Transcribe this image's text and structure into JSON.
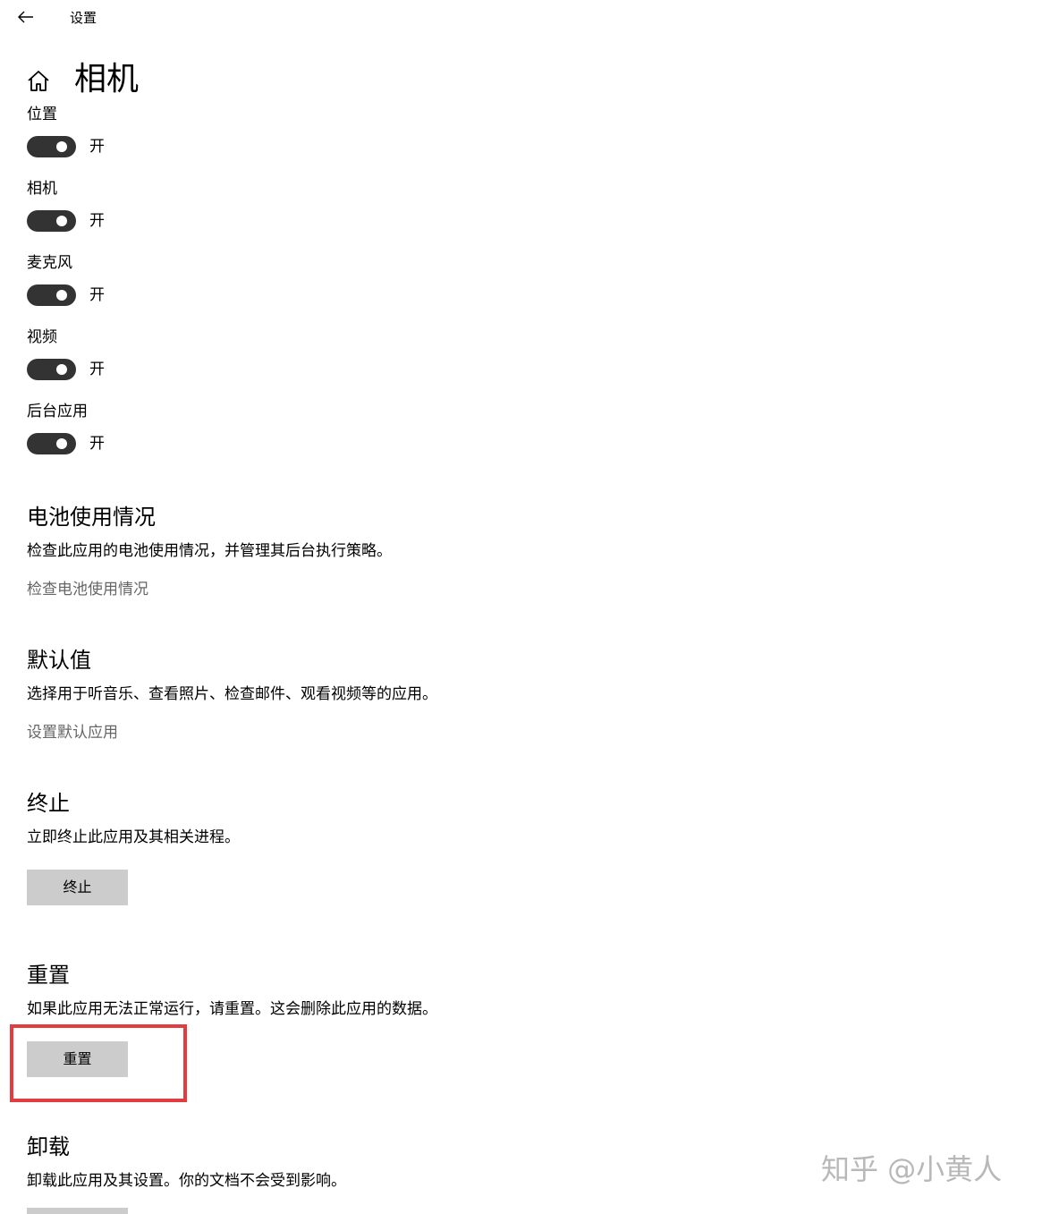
{
  "window": {
    "title": "设置"
  },
  "header": {
    "title": "相机"
  },
  "permissions": [
    {
      "label": "位置",
      "state": "开",
      "on": true
    },
    {
      "label": "相机",
      "state": "开",
      "on": true
    },
    {
      "label": "麦克风",
      "state": "开",
      "on": true
    },
    {
      "label": "视频",
      "state": "开",
      "on": true
    },
    {
      "label": "后台应用",
      "state": "开",
      "on": true
    }
  ],
  "battery": {
    "title": "电池使用情况",
    "desc": "检查此应用的电池使用情况，并管理其后台执行策略。",
    "link": "检查电池使用情况"
  },
  "defaults": {
    "title": "默认值",
    "desc": "选择用于听音乐、查看照片、检查邮件、观看视频等的应用。",
    "link": "设置默认应用"
  },
  "terminate": {
    "title": "终止",
    "desc": "立即终止此应用及其相关进程。",
    "button": "终止"
  },
  "reset": {
    "title": "重置",
    "desc": "如果此应用无法正常运行，请重置。这会删除此应用的数据。",
    "button": "重置"
  },
  "uninstall": {
    "title": "卸载",
    "desc": "卸载此应用及其设置。你的文档不会受到影响。"
  },
  "watermark": "知乎 @小黄人",
  "colors": {
    "toggle_on": "#333333",
    "button_bg": "#cccccc",
    "link": "#666666",
    "highlight": "#e23c41"
  }
}
